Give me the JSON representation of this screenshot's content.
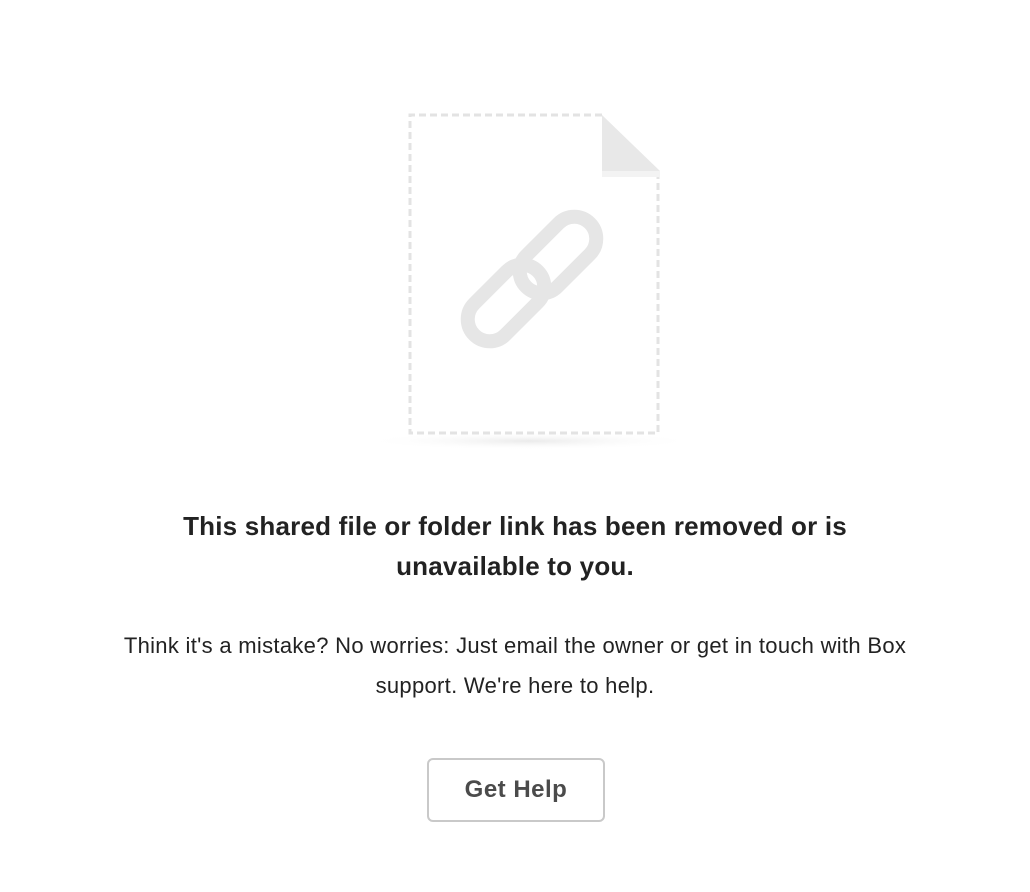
{
  "illustration": {
    "file_icon": "file-outline-icon",
    "link_icon": "chain-link-icon"
  },
  "heading": "This shared file or folder link has been removed or is unavailable to you.",
  "message": "Think it's a mistake? No worries: Just email the owner or get in touch with Box support. We're here to help.",
  "help_button": {
    "label": "Get Help"
  },
  "colors": {
    "text": "#222222",
    "icon_gray": "#e6e6e6",
    "button_border": "#c9c9c9",
    "button_text": "#4b4b4b"
  }
}
